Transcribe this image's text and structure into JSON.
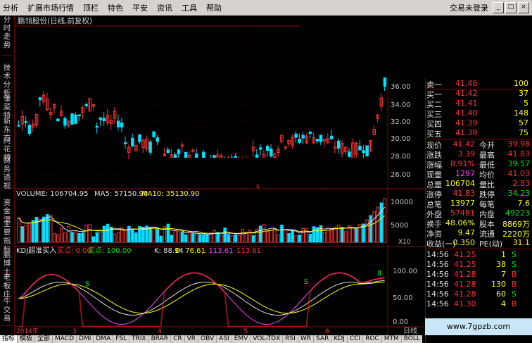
{
  "menu": {
    "items": [
      "分析",
      "扩展市场行情",
      "顶栏",
      "特色",
      "平安",
      "资讯",
      "工具",
      "帮助"
    ],
    "login": "交易未登录",
    "win_buttons": [
      "_",
      "□",
      "×"
    ]
  },
  "left_tabs": [
    "分时走势",
    "技术分析",
    "雏菜特",
    "新东方",
    "同花顺",
    "财务透视",
    "资金流",
    "主要指标",
    "鹏博士",
    "老板庄",
    "牛交易"
  ],
  "chart": {
    "title": "鹏翎股份(日线,前复权)",
    "price_ticks": [
      "36.00",
      "34.00",
      "32.00",
      "30.00",
      "28.00",
      "26.00"
    ],
    "marker_s": "s",
    "volume_header": {
      "label": "VOLUME: 106704.95",
      "ma5": "MA5: 57150.90",
      "ma10": "MA10: 35130.90"
    },
    "volume_ticks": [
      "10000",
      "5000",
      "5000"
    ],
    "volume_unit": "X10",
    "kdj_header": {
      "label": "KDJ超准买入",
      "buy_label": "买点: 0.00",
      "sell_label": "卖点: 100.00",
      "k": "K: 88.94",
      "d": "D: 76.61",
      "j": "J: 113.61",
      "j2": "113.61"
    },
    "kdj_ticks": [
      "100.00",
      "50.00",
      "0.00"
    ],
    "date_labels": [
      "2014年",
      "3",
      "4",
      "5",
      "6"
    ],
    "kdj_s_markers": [
      "S",
      "S",
      "S"
    ],
    "kdj_i_marker": "II",
    "period_label": "日线"
  },
  "quote": {
    "ask": [
      {
        "label": "卖一",
        "price": "41.46",
        "vol": "100"
      }
    ],
    "bids": [
      {
        "label": "买一",
        "price": "41.42",
        "vol": "37"
      },
      {
        "label": "买二",
        "price": "41.41",
        "vol": "5"
      },
      {
        "label": "买三",
        "price": "41.40",
        "vol": "148"
      },
      {
        "label": "买四",
        "price": "41.39",
        "vol": "57"
      },
      {
        "label": "买五",
        "price": "41.38",
        "vol": "75"
      }
    ],
    "stats": [
      {
        "l1": "现价",
        "v1": "41.42",
        "l2": "今开",
        "v2": "39.98"
      },
      {
        "l1": "涨跌",
        "v1": "3.39",
        "l2": "最高",
        "v2": "41.83"
      },
      {
        "l1": "涨幅",
        "v1": "8.91%",
        "l2": "最低",
        "v2": "39.57"
      },
      {
        "l1": "现量",
        "v1": "1297",
        "l2": "均价",
        "v2": "41.03"
      },
      {
        "l1": "总量",
        "v1": "106704",
        "l2": "量比",
        "v2": "2.83"
      },
      {
        "l1": "涨停",
        "v1": "41.83",
        "l2": "跌停",
        "v2": "34.23"
      },
      {
        "l1": "总笔",
        "v1": "13977",
        "l2": "每笔",
        "v2": "7.6"
      },
      {
        "l1": "外盘",
        "v1": "57481",
        "l2": "内盘",
        "v2": "49223"
      },
      {
        "l1": "换手",
        "v1": "48.06%",
        "l2": "股本",
        "v2": "8869万"
      },
      {
        "l1": "净资",
        "v1": "9.47",
        "l2": "流通",
        "v2": "2220万"
      },
      {
        "l1": "收益(一)",
        "v1": "0.350",
        "l2": "PE(动)",
        "v2": "31.1"
      }
    ],
    "ticks": [
      {
        "time": "14:56",
        "price": "41.25",
        "vol": "1",
        "dir": "S"
      },
      {
        "time": "14:56",
        "price": "41.25",
        "vol": "38",
        "dir": "S"
      },
      {
        "time": "14:56",
        "price": "41.28",
        "vol": "7",
        "dir": "B"
      },
      {
        "time": "14:56",
        "price": "41.28",
        "vol": "130",
        "dir": "B"
      },
      {
        "time": "14:56",
        "price": "41.28",
        "vol": "60",
        "dir": "S"
      },
      {
        "time": "14:56",
        "price": "41.30",
        "vol": "4",
        "dir": "B"
      },
      {
        "time": "14:56",
        "price": "41.31",
        "vol": "4",
        "dir": "B"
      }
    ]
  },
  "bottom_tabs": [
    "指标",
    "模板",
    "全部",
    "MACD",
    "DMI",
    "DMA",
    "FSL",
    "TRIX",
    "BRAR",
    "CR",
    "VR",
    "OBV",
    "ASI",
    "EMV",
    "VOL-TDX",
    "RSI",
    "WR",
    "SAR",
    "KDJ",
    "CCI",
    "ROC",
    "MTM",
    "BOLL",
    "PSY",
    "MCST"
  ],
  "watermark": "www.7gpzb.com",
  "colors": {
    "up": "#ff3232",
    "down": "#00e0ff",
    "bg": "#000000",
    "frame": "#8a0000"
  }
}
